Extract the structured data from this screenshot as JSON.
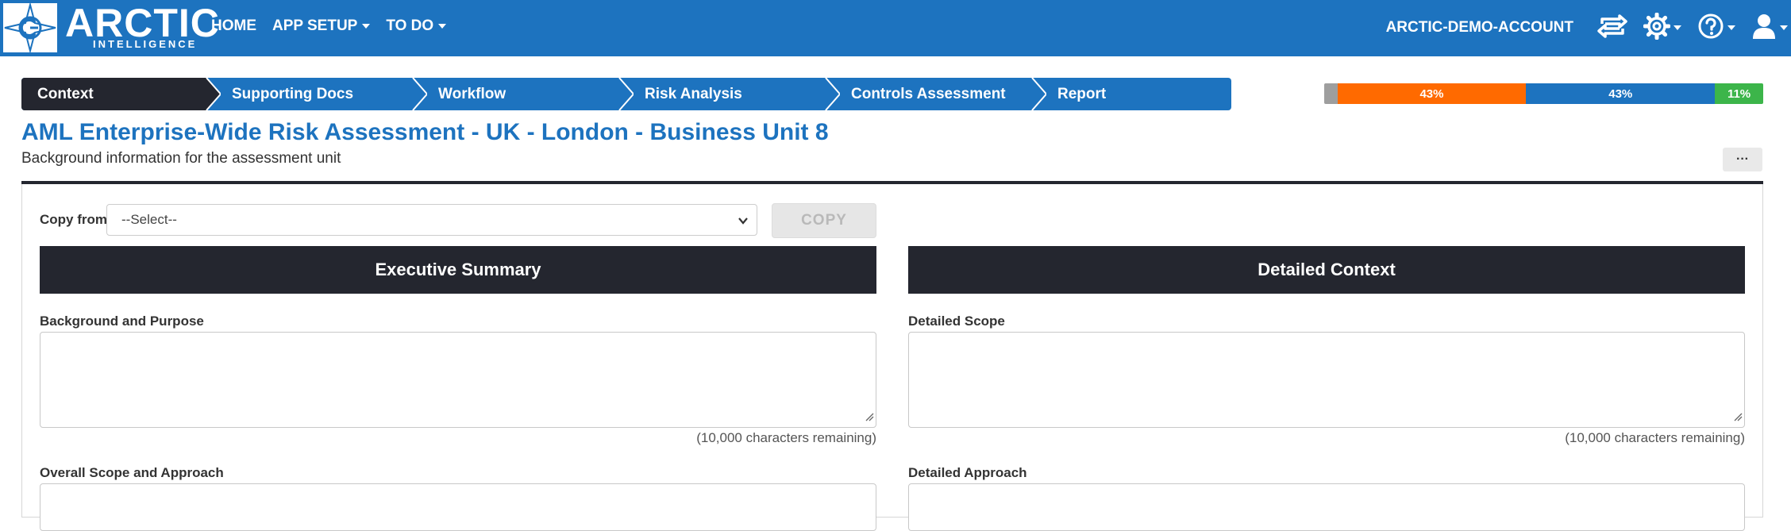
{
  "logo": {
    "name": "ARCTIC",
    "sub": "INTELLIGENCE"
  },
  "nav": {
    "home": "HOME",
    "app_setup": "APP SETUP",
    "to_do": "TO DO",
    "account": "ARCTIC-DEMO-ACCOUNT"
  },
  "steps": [
    "Context",
    "Supporting Docs",
    "Workflow",
    "Risk Analysis",
    "Controls Assessment",
    "Report"
  ],
  "progress": [
    {
      "label": "",
      "value": 3,
      "color": "#9e9e9e"
    },
    {
      "label": "43%",
      "value": 43,
      "color": "#ff6a00"
    },
    {
      "label": "43%",
      "value": 43,
      "color": "#1d73bf"
    },
    {
      "label": "11%",
      "value": 11,
      "color": "#3cb54a"
    }
  ],
  "page": {
    "title": "AML Enterprise-Wide Risk Assessment - UK - London - Business Unit 8",
    "subtitle": "Background information for the assessment unit",
    "more": "···"
  },
  "copy": {
    "label": "Copy from",
    "select_value": "--Select--",
    "button": "COPY"
  },
  "sections": {
    "left": {
      "title": "Executive Summary",
      "fields": [
        {
          "label": "Background and Purpose",
          "remaining": "(10,000 characters remaining)"
        },
        {
          "label": "Overall Scope and Approach"
        }
      ]
    },
    "right": {
      "title": "Detailed Context",
      "fields": [
        {
          "label": "Detailed Scope",
          "remaining": "(10,000 characters remaining)"
        },
        {
          "label": "Detailed Approach"
        }
      ]
    }
  },
  "colors": {
    "brand": "#1d73bf",
    "dark": "#24262f"
  },
  "icons": [
    "retweet-icon",
    "gear-icon",
    "help-icon",
    "user-icon",
    "chevron-down-icon",
    "resize-handle-icon"
  ]
}
